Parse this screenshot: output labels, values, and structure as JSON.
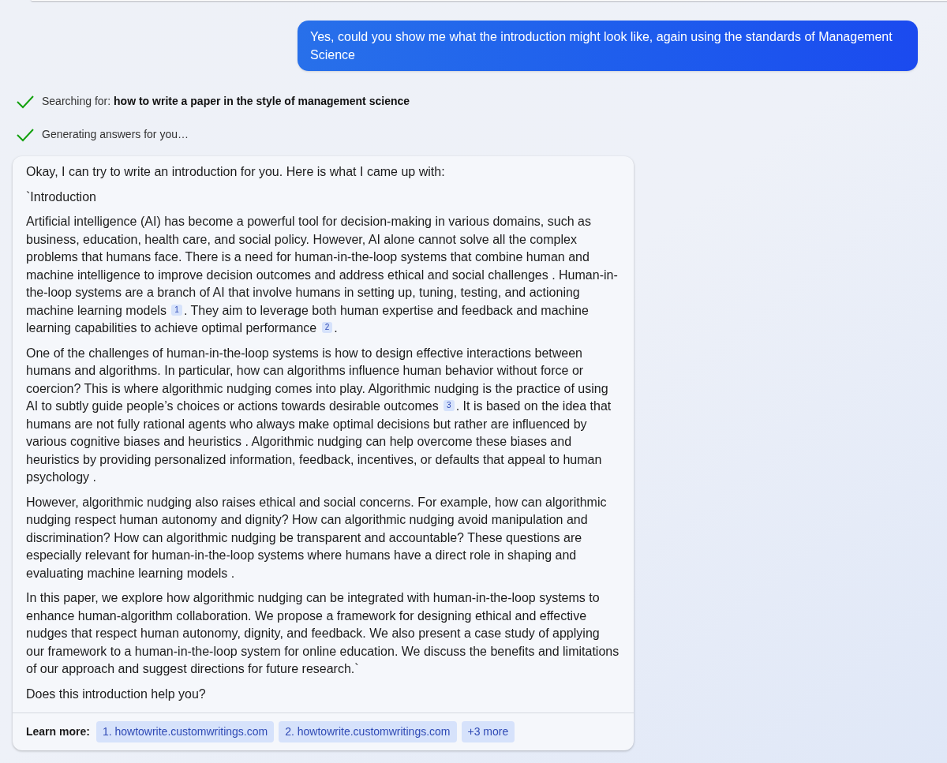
{
  "user_message": "Yes, could you show me what the introduction might look like, again using the standards of Management Science",
  "progress": [
    {
      "label": "Searching for: ",
      "query": "how to write a paper in the style of management science",
      "done": true
    },
    {
      "label": "Generating answers for you…",
      "done": true
    }
  ],
  "answer": {
    "intro": "Okay, I can try to write an introduction for you. Here is what I came up with:",
    "heading": "`Introduction",
    "paragraphs": [
      [
        {
          "text": "Artificial intelligence (AI) has become a powerful tool for decision-making in various domains, such as business, education, health care, and social policy. However, AI alone cannot solve all the complex problems that humans face. There is a need for human-in-the-loop systems that combine human and machine intelligence to improve decision outcomes and address ethical and social challenges . Human-in-the-loop systems are a branch of AI that involve humans in setting up, tuning, testing, and actioning machine learning models "
        },
        {
          "cite": "1"
        },
        {
          "text": ". They aim to leverage both human expertise and feedback and machine learning capabilities to achieve optimal performance "
        },
        {
          "cite": "2"
        },
        {
          "text": "."
        }
      ],
      [
        {
          "text": "One of the challenges of human-in-the-loop systems is how to design effective interactions between humans and algorithms. In particular, how can algorithms influence human behavior without force or coercion? This is where algorithmic nudging comes into play. Algorithmic nudging is the practice of using AI to subtly guide people’s choices or actions towards desirable outcomes "
        },
        {
          "cite": "3"
        },
        {
          "text": ". It is based on the idea that humans are not fully rational agents who always make optimal decisions but rather are influenced by various cognitive biases and heuristics . Algorithmic nudging can help overcome these biases and heuristics by providing personalized information, feedback, incentives, or defaults that appeal to human psychology ."
        }
      ],
      [
        {
          "text": "However, algorithmic nudging also raises ethical and social concerns. For example, how can algorithmic nudging respect human autonomy and dignity? How can algorithmic nudging avoid manipulation and discrimination? How can algorithmic nudging be transparent and accountable? These questions are especially relevant for human-in-the-loop systems where humans have a direct role in shaping and evaluating machine learning models ."
        }
      ],
      [
        {
          "text": "In this paper, we explore how algorithmic nudging can be integrated with human-in-the-loop systems to enhance human-algorithm collaboration. We propose a framework for designing ethical and effective nudges that respect human autonomy, dignity, and feedback. We also present a case study of applying our framework to a human-in-the-loop system for online education. We discuss the benefits and limitations of our approach and suggest directions for future research.`"
        }
      ]
    ],
    "closing": "Does this introduction help you?",
    "learn_more_label": "Learn more:",
    "sources": [
      "1. howtowrite.customwritings.com",
      "2. howtowrite.customwritings.com",
      "+3 more"
    ]
  }
}
